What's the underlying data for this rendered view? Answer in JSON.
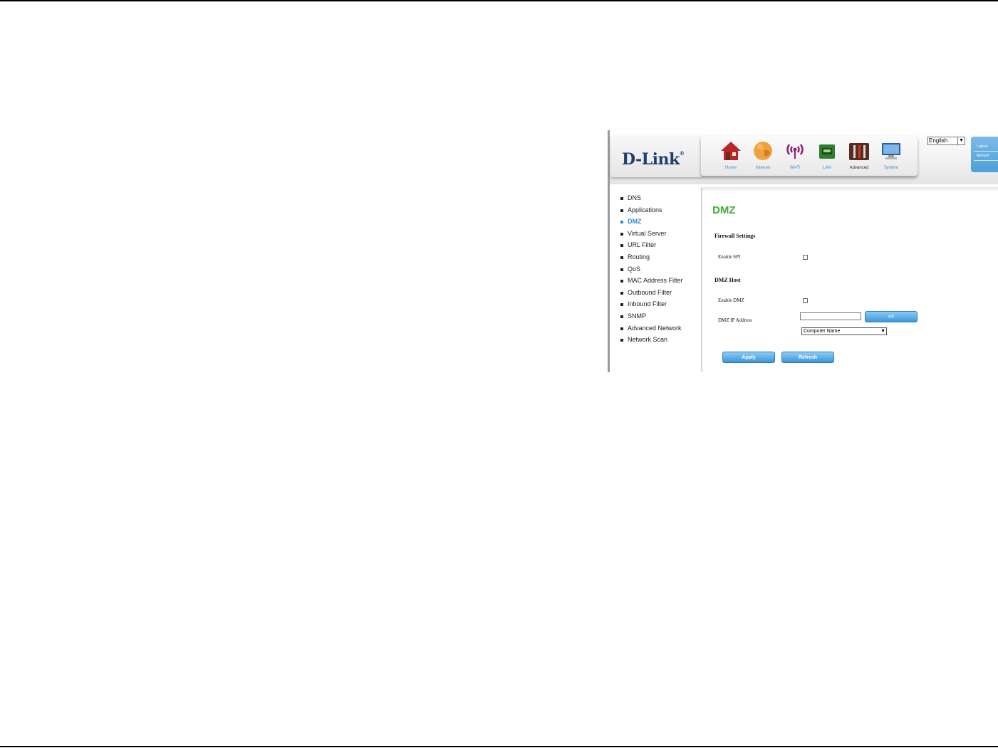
{
  "brand": {
    "logo": "D-Link",
    "trademark": "®"
  },
  "nav": [
    {
      "label": "Home",
      "icon": "home-icon",
      "active": false
    },
    {
      "label": "Internet",
      "icon": "globe-icon",
      "active": false
    },
    {
      "label": "Wi-Fi",
      "icon": "wifi-icon",
      "active": false
    },
    {
      "label": "LAN",
      "icon": "lan-icon",
      "active": false
    },
    {
      "label": "Advanced",
      "icon": "tools-icon",
      "active": true
    },
    {
      "label": "System",
      "icon": "monitor-icon",
      "active": false
    }
  ],
  "language": {
    "selected": "English"
  },
  "side_tab": {
    "logout": "Logout",
    "refresh": "Refresh"
  },
  "menu": [
    {
      "label": "DNS",
      "active": false
    },
    {
      "label": "Applications",
      "active": false
    },
    {
      "label": "DMZ",
      "active": true
    },
    {
      "label": "Virtual Server",
      "active": false
    },
    {
      "label": "URL Filter",
      "active": false
    },
    {
      "label": "Routing",
      "active": false
    },
    {
      "label": "QoS",
      "active": false
    },
    {
      "label": "MAC Address Filter",
      "active": false
    },
    {
      "label": "Outbound Filter",
      "active": false
    },
    {
      "label": "Inbound Filter",
      "active": false
    },
    {
      "label": "SNMP",
      "active": false
    },
    {
      "label": "Advanced Network",
      "active": false
    },
    {
      "label": "Network Scan",
      "active": false
    }
  ],
  "content": {
    "title": "DMZ",
    "firewall_section": "Firewall Settings",
    "enable_spi_label": "Enable SPI",
    "enable_spi_checked": false,
    "dmz_section": "DMZ Host",
    "enable_dmz_label": "Enable DMZ",
    "enable_dmz_checked": false,
    "dmz_ip_label": "DMZ IP Address",
    "dmz_ip_value": "",
    "copy_button": "<<",
    "computer_select": "Computer Name",
    "apply_button": "Apply",
    "refresh_button": "Refresh"
  },
  "colors": {
    "title_green": "#46a83c",
    "link_blue": "#2a8cd6",
    "button_blue": "#3d97db",
    "logo_navy": "#1f3e72"
  }
}
